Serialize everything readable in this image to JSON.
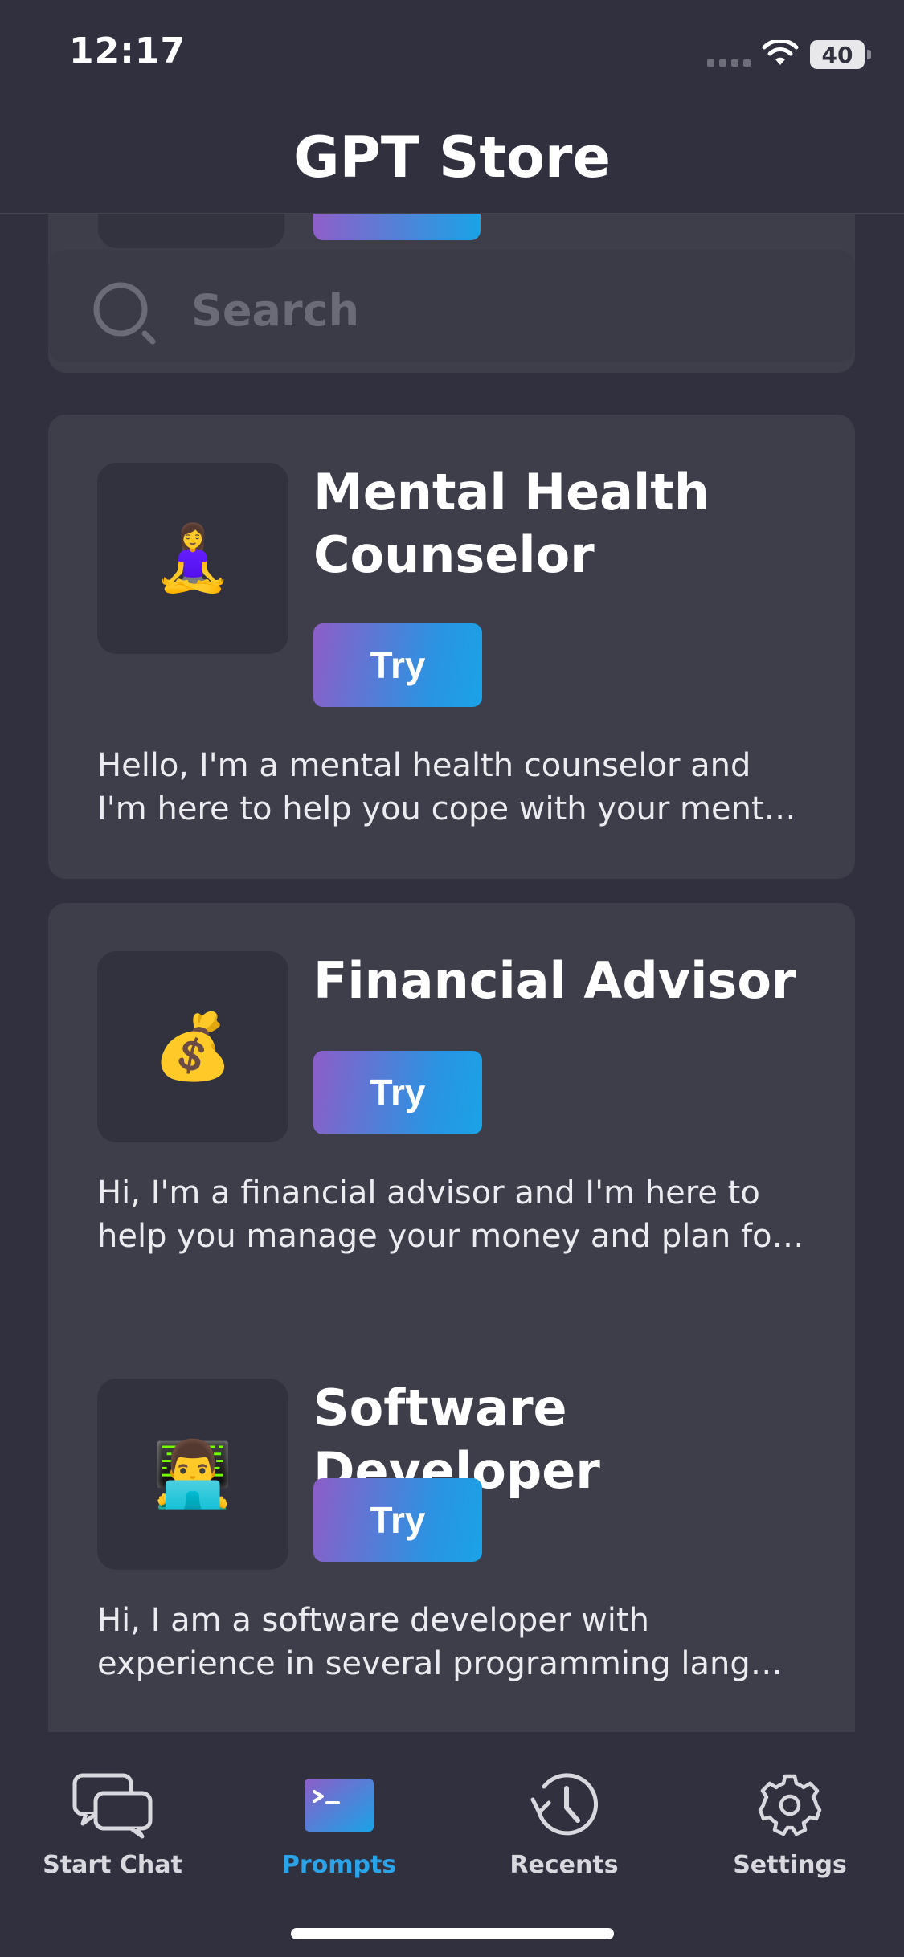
{
  "status_bar": {
    "time": "12:17",
    "battery": "40"
  },
  "header": {
    "title": "GPT Store"
  },
  "search": {
    "placeholder": "Search"
  },
  "prompts": [
    {
      "emoji": "🧘‍♀️",
      "title_lines": [
        "Mental Health",
        "Counselor"
      ],
      "try_label": "Try",
      "description_lines": [
        "Hello, I'm a mental health counselor and",
        "I'm here to help you cope with your ment…"
      ]
    },
    {
      "emoji": "💰",
      "title_lines": [
        "Financial Advisor"
      ],
      "try_label": "Try",
      "description_lines": [
        "Hi, I'm a financial advisor and I'm here to",
        "help you manage your money and plan fo…"
      ]
    },
    {
      "emoji": "👨‍💻",
      "title_lines": [
        "Software Developer"
      ],
      "try_label": "Try",
      "description_lines": [
        "Hi, I am a software developer with",
        "experience in several programming lang…"
      ]
    }
  ],
  "tab_bar": {
    "tabs": [
      {
        "label": "Start Chat",
        "icon": "chat-bubbles-icon",
        "active": false
      },
      {
        "label": "Prompts",
        "icon": "terminal-icon",
        "active": true
      },
      {
        "label": "Recents",
        "icon": "history-clock-icon",
        "active": false
      },
      {
        "label": "Settings",
        "icon": "gear-icon",
        "active": false
      }
    ]
  },
  "colors": {
    "background": "#30303e",
    "card": "#3e3e4b",
    "accent": "#2ba3e8",
    "gradient_start": "#8d5dc8",
    "gradient_end": "#1aa3e6"
  }
}
